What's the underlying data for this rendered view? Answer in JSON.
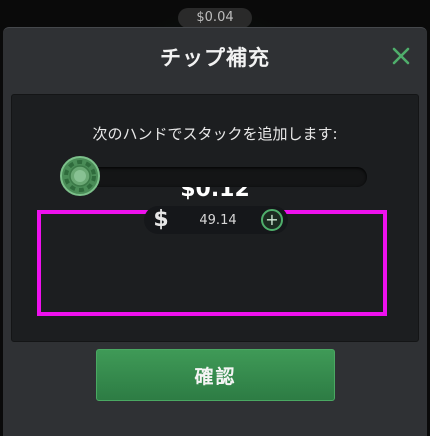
{
  "background": {
    "pot_amount": "$0.04"
  },
  "dialog": {
    "title": "チップ補充",
    "close_icon": "close-x-icon",
    "message": "次のハンドでスタックを追加します:",
    "amount": "$0.12",
    "slider": {
      "value_fraction": 0.0,
      "knob_icon": "poker-chip-icon"
    },
    "stepper": {
      "currency_icon": "dollar-sign-icon",
      "value": "49.14",
      "plus_icon": "plus-icon"
    },
    "confirm_label": "確認"
  },
  "colors": {
    "accent_green": "#3f9a57",
    "highlight_magenta": "#ee11ee",
    "close_green": "#4fae6b"
  }
}
